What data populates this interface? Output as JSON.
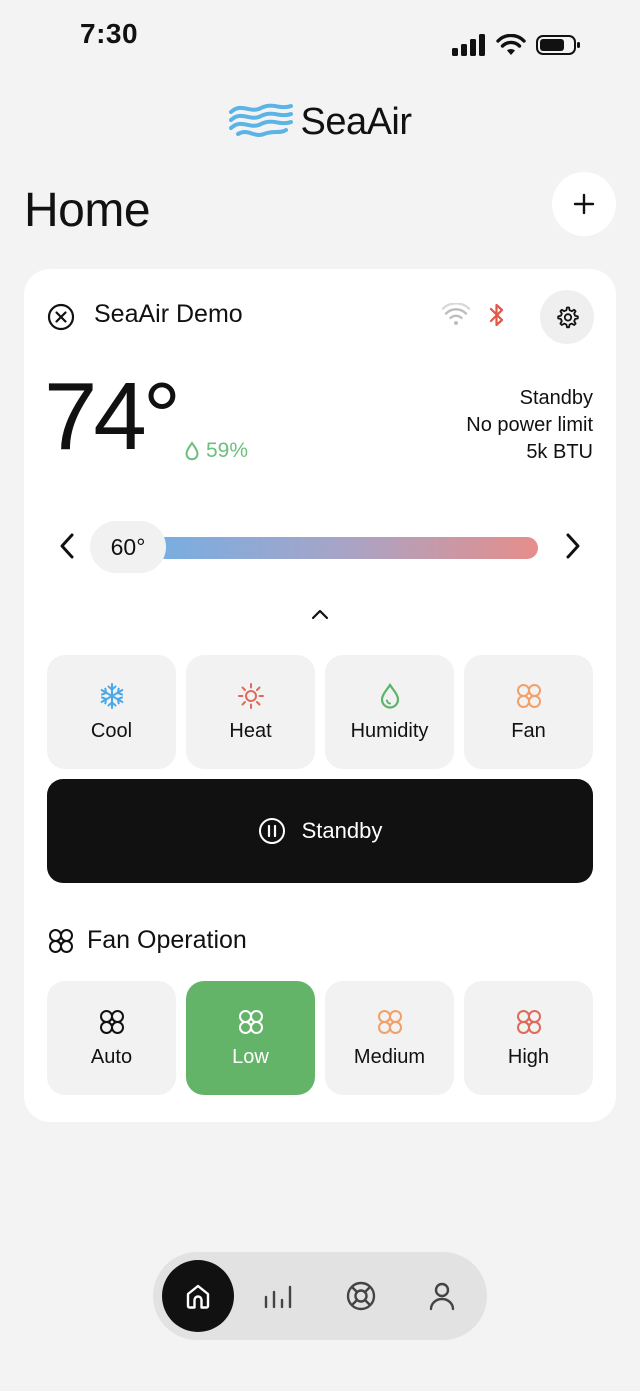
{
  "status_bar": {
    "time": "7:30"
  },
  "logo": {
    "text": "SeaAir",
    "color": "#5bb3e6"
  },
  "header": {
    "title": "Home",
    "add_label": "+"
  },
  "device": {
    "name": "SeaAir Demo",
    "temperature": "74°",
    "humidity": "59%",
    "status_lines": [
      "Standby",
      "No power limit",
      "5k BTU"
    ],
    "setpoint": "60°"
  },
  "modes": [
    {
      "label": "Cool",
      "icon": "snowflake-icon",
      "color": "#4aa8e8"
    },
    {
      "label": "Heat",
      "icon": "sun-icon",
      "color": "#e06a5a"
    },
    {
      "label": "Humidity",
      "icon": "droplet-icon",
      "color": "#5cb36a"
    },
    {
      "label": "Fan",
      "icon": "fan-icon",
      "color": "#f2a06a"
    }
  ],
  "standby_button": {
    "label": "Standby"
  },
  "fan_operation": {
    "title": "Fan Operation",
    "options": [
      {
        "label": "Auto",
        "color": "#111111"
      },
      {
        "label": "Low",
        "color": "#ffffff",
        "selected": true
      },
      {
        "label": "Medium",
        "color": "#f2a06a"
      },
      {
        "label": "High",
        "color": "#e06a5a"
      }
    ]
  },
  "nav": [
    "home-icon",
    "stats-icon",
    "support-icon",
    "profile-icon"
  ]
}
